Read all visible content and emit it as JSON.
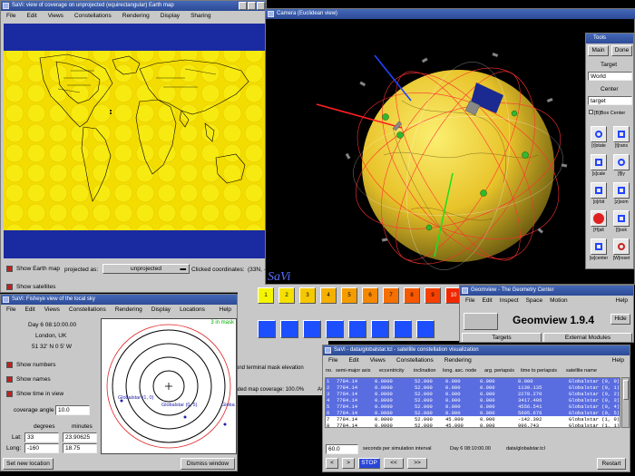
{
  "desktop": {
    "bg": "#000000"
  },
  "map_window": {
    "title": "SaVi: view of coverage on unprojected (equirectangular) Earth map",
    "menu": [
      "File",
      "Edit",
      "Views",
      "Constellations",
      "Rendering",
      "Display",
      "Sharing"
    ],
    "show_earth_map_label": "Show Earth map",
    "projected_as_label": "projected as:",
    "projection_value": "unprojected",
    "clicked_coords_label": "Clicked coordinates:",
    "clicked_coords_value": "(33N, -",
    "show_satellites_label": "Show satellites"
  },
  "camera_window": {
    "title": "Camera (Euclidean view)",
    "savi_logo": "SaVi"
  },
  "tools_window": {
    "title": "Tools",
    "main_label": "Main",
    "done_label": "Done",
    "target_heading": "Target",
    "target_value": "World",
    "center_heading": "Center",
    "center_value": "target",
    "bbox_label": "[B]Box Center",
    "tools": [
      {
        "label": "[r]otate",
        "icon": "rotate-icon"
      },
      {
        "label": "[t]rans",
        "icon": "translate-icon"
      },
      {
        "label": "[s]cale",
        "icon": "scale-icon"
      },
      {
        "label": "[f]ly",
        "icon": "fly-icon"
      },
      {
        "label": "[o]rbit",
        "icon": "orbit-icon"
      },
      {
        "label": "[z]oom",
        "icon": "zoom-icon"
      },
      {
        "label": "[H]alt",
        "icon": "stop-icon"
      },
      {
        "label": "[l]ook",
        "icon": "look-icon"
      },
      {
        "label": "[w]center",
        "icon": "center-icon"
      },
      {
        "label": "[W]reset",
        "icon": "reset-icon"
      }
    ],
    "zoom_top": "[z]oom",
    "orbit_top": "[o]rbit"
  },
  "strip": {
    "numbers": [
      "1",
      "2",
      "3",
      "4",
      "5",
      "6",
      "7",
      "8",
      "9",
      "10",
      "11"
    ],
    "colors": [
      "#f5f500",
      "#f5e000",
      "#f5c800",
      "#f5b000",
      "#f59c00",
      "#f58800",
      "#f57000",
      "#f55800",
      "#f54000",
      "#f02800",
      "#e81800"
    ],
    "mask_label": "und terminal mask elevation",
    "coverage_label": "ated map coverage: 100.0%",
    "av_label": "Av"
  },
  "fisheye_window": {
    "title": "SaVi: Fisheye view of the local sky",
    "menu": [
      "File",
      "Edit",
      "Views",
      "Constellations",
      "Rendering",
      "Display",
      "Locations",
      "Help"
    ],
    "time": "Day 6  08:10:00.00",
    "city": "London, UK",
    "coords": "51 32' N  0  5' W",
    "show_numbers": "Show numbers",
    "show_names": "Show names",
    "show_time": "Show time in view",
    "coverage_angle_label": "coverage angle",
    "coverage_angle_value": "10.0",
    "degrees_label": "degrees",
    "minutes_label": "minutes",
    "lat_label": "Lat:",
    "lat_deg": "33",
    "lat_min": "23.90625",
    "long_label": "Long:",
    "long_deg": "-160",
    "long_min": "18.75",
    "set_location": "Set new location",
    "dismiss": "Dismiss window",
    "in_mask": "3 in mask",
    "sat_labels": [
      "Globalstar (1, 0)",
      "Globalstar (0, 5)",
      "Globa"
    ]
  },
  "geomview_window": {
    "title": "Geomview - The Geometry Center",
    "menu": [
      "File",
      "Edit",
      "Inspect",
      "Space",
      "Motion",
      "Help"
    ],
    "app_title": "Geomview 1.9.4",
    "hide_label": "Hide",
    "targets_label": "Targets",
    "external_label": "External Modules"
  },
  "table_window": {
    "title": "SaVi - data/globalstar.tcl - satellite constellation visualization",
    "menu": [
      "File",
      "Edit",
      "Views",
      "Constellations",
      "Rendering",
      "Help"
    ],
    "headers": [
      "no.",
      "semi-major axis",
      "eccentricity",
      "inclination",
      "long. asc. node",
      "arg. periapsis",
      "time to periapsis",
      "satellite name"
    ],
    "rows": [
      {
        "no": "1",
        "a": "7784.14",
        "e": "0.0000",
        "i": "52.000",
        "node": "0.000",
        "arg": "0.000",
        "tp": "0.000",
        "name": "Globalstar (0, 0)",
        "sel": true
      },
      {
        "no": "2",
        "a": "7784.14",
        "e": "0.0000",
        "i": "52.000",
        "node": "0.000",
        "arg": "0.000",
        "tp": "1139.135",
        "name": "Globalstar (0, 1)",
        "sel": true
      },
      {
        "no": "3",
        "a": "7784.14",
        "e": "0.0000",
        "i": "52.000",
        "node": "0.000",
        "arg": "0.000",
        "tp": "2278.270",
        "name": "Globalstar (0, 2)",
        "sel": true
      },
      {
        "no": "4",
        "a": "7784.14",
        "e": "0.0000",
        "i": "52.000",
        "node": "0.000",
        "arg": "0.000",
        "tp": "3417.406",
        "name": "Globalstar (0, 3)",
        "sel": true
      },
      {
        "no": "5",
        "a": "7784.14",
        "e": "0.0000",
        "i": "52.000",
        "node": "0.000",
        "arg": "0.000",
        "tp": "4556.541",
        "name": "Globalstar (0, 4)",
        "sel": true
      },
      {
        "no": "6",
        "a": "7784.14",
        "e": "0.0000",
        "i": "52.000",
        "node": "0.000",
        "arg": "0.000",
        "tp": "5695.676",
        "name": "Globalstar (0, 5)",
        "sel": true
      },
      {
        "no": "7",
        "a": "7784.14",
        "e": "0.0000",
        "i": "52.000",
        "node": "45.000",
        "arg": "0.000",
        "tp": "-142.392",
        "name": "Globalstar (1, 0)",
        "sel": false
      },
      {
        "no": "8",
        "a": "7784.14",
        "e": "0.0000",
        "i": "52.000",
        "node": "45.000",
        "arg": "0.000",
        "tp": "996.743",
        "name": "Globalstar (1, 1)",
        "sel": false
      }
    ],
    "sim_interval_value": "60.0",
    "sim_interval_label": "seconds per simulation interval",
    "time": "Day 6  08:10:00.00",
    "file": "data/globalstar.tcl",
    "controls": [
      "<",
      ">",
      "STOP",
      "<<",
      ">>"
    ],
    "restart": "Restart"
  }
}
